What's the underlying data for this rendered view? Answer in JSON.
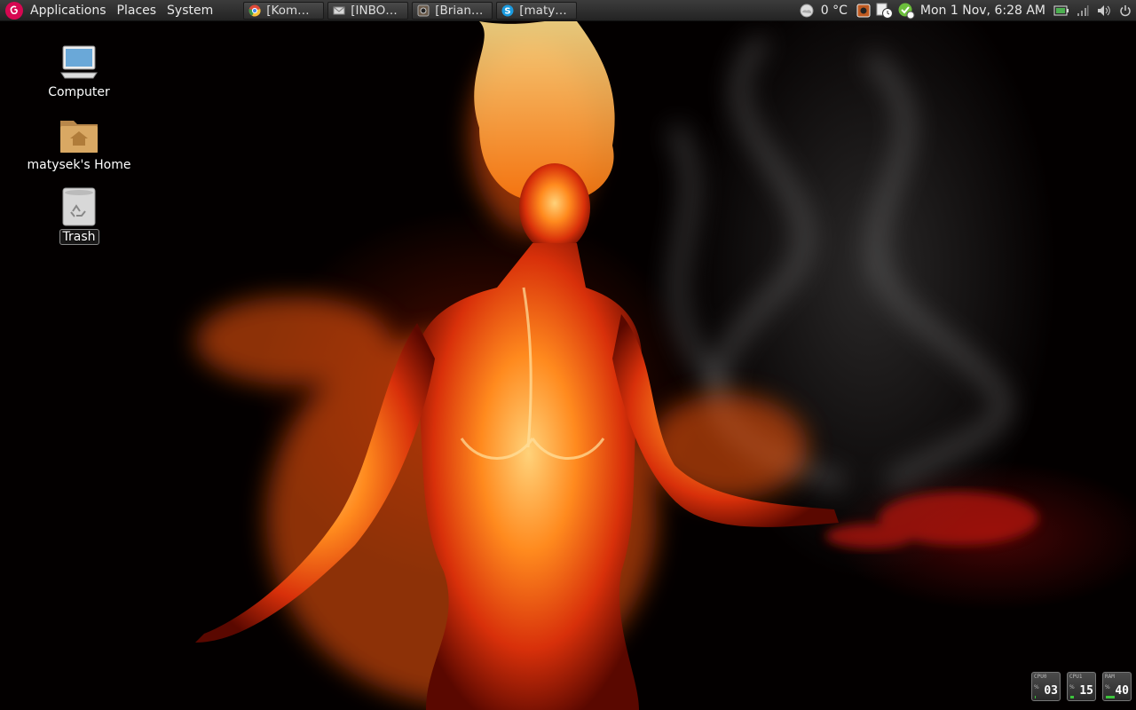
{
  "top_panel": {
    "menus": [
      "Applications",
      "Places",
      "System"
    ],
    "tasks": [
      {
        "label": "[Kom…",
        "icon": "chrome-icon"
      },
      {
        "label": "[INBO…",
        "icon": "mail-icon"
      },
      {
        "label": "[Brian…",
        "icon": "media-icon"
      },
      {
        "label": "[maty…",
        "icon": "skype-icon"
      }
    ],
    "weather": "0 °C",
    "clock": "Mon  1 Nov,  6:28 AM"
  },
  "desktop": {
    "icons": [
      {
        "label": "Computer",
        "icon": "computer-icon"
      },
      {
        "label": "matysek's Home",
        "icon": "home-folder-icon"
      },
      {
        "label": "Trash",
        "icon": "trash-icon"
      }
    ]
  },
  "monitors": [
    {
      "label": "CPU0",
      "unit": "%",
      "value": "03",
      "level": 0.03
    },
    {
      "label": "CPU1",
      "unit": "%",
      "value": "15",
      "level": 0.15
    },
    {
      "label": "RAM",
      "unit": "%",
      "value": "40",
      "level": 0.4
    }
  ],
  "colors": {
    "panel": "#2f2f2f",
    "debian_red": "#d70751",
    "battery_green": "#4caf50",
    "monitor_bar": "#3cc43c"
  }
}
